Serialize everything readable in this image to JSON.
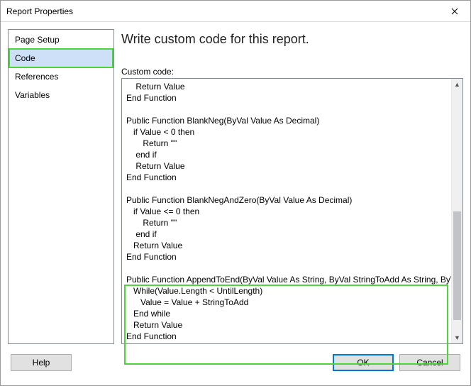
{
  "window": {
    "title": "Report Properties"
  },
  "sidebar": {
    "items": [
      {
        "label": "Page Setup",
        "selected": false
      },
      {
        "label": "Code",
        "selected": true
      },
      {
        "label": "References",
        "selected": false
      },
      {
        "label": "Variables",
        "selected": false
      }
    ]
  },
  "main": {
    "heading": "Write custom code for this report.",
    "code_label": "Custom code:",
    "code": "    Return Value\nEnd Function\n\nPublic Function BlankNeg(ByVal Value As Decimal)\n   if Value < 0 then\n       Return \"\"\n    end if\n    Return Value\nEnd Function\n\nPublic Function BlankNegAndZero(ByVal Value As Decimal)\n   if Value <= 0 then\n       Return \"\"\n    end if\n   Return Value\nEnd Function\n\nPublic Function AppendToEnd(ByVal Value As String, ByVal StringToAdd As String, ByVal UntilLength As Integer)\n   While(Value.Length < UntilLength)\n      Value = Value + StringToAdd\n   End while\n   Return Value\nEnd Function"
  },
  "footer": {
    "help": "Help",
    "ok": "OK",
    "cancel": "Cancel"
  }
}
